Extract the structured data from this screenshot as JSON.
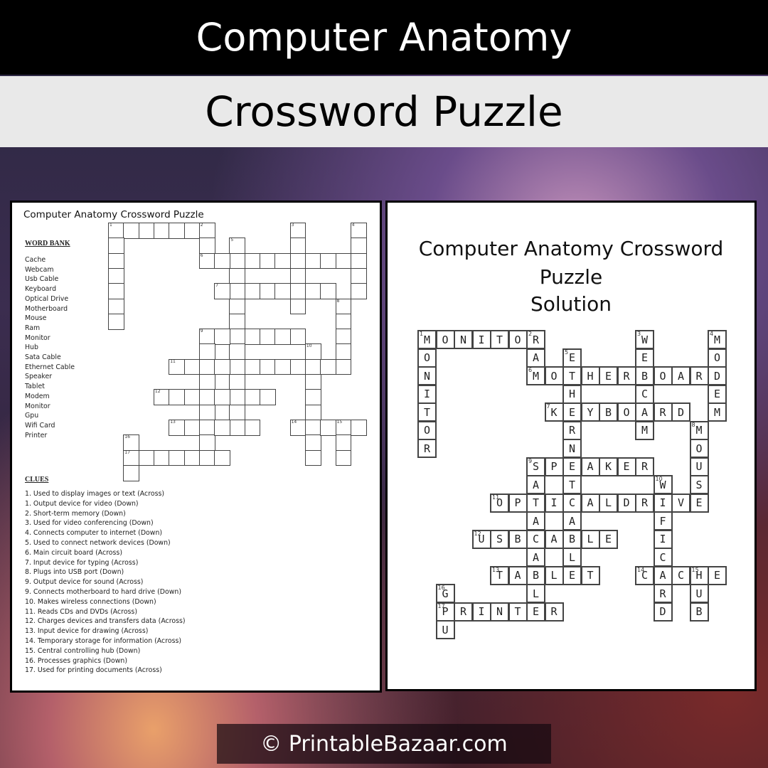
{
  "header": {
    "title": "Computer Anatomy",
    "subtitle": "Crossword Puzzle"
  },
  "puzzle": {
    "title": "Computer Anatomy Crossword Puzzle",
    "word_bank_heading": "WORD BANK",
    "word_bank": [
      "Cache",
      "Webcam",
      "Usb Cable",
      "Keyboard",
      "Optical Drive",
      "Motherboard",
      "Mouse",
      "Ram",
      "Monitor",
      "Hub",
      "Sata Cable",
      "Ethernet Cable",
      "Speaker",
      "Tablet",
      "Modem",
      "Monitor",
      "Gpu",
      "Wifi Card",
      "Printer"
    ],
    "clues_heading": "CLUES",
    "clues": [
      "1. Used to display images or text (Across)",
      "1. Output device for video (Down)",
      "2. Short-term  memory (Down)",
      "3. Used for video conferencing (Down)",
      "4. Connects computer to internet (Down)",
      "5. Used to connect network devices (Down)",
      "6. Main circuit board (Across)",
      "7. Input device for typing (Across)",
      "8. Plugs into USB port (Down)",
      "9. Output device for sound (Across)",
      "9. Connects motherboard  to hard drive (Down)",
      "10. Makes wireless connections (Down)",
      "11. Reads CDs and DVDs (Across)",
      "12. Charges devices and transfers data (Across)",
      "13. Input device for drawing (Across)",
      "14. Temporary storage for information (Across)",
      "15. Central controlling hub (Down)",
      "16. Processes graphics (Down)",
      "17. Used for printing documents (Across)"
    ]
  },
  "solution": {
    "title_line1": "Computer Anatomy Crossword",
    "title_line2": "Puzzle",
    "label": "Solution"
  },
  "grid_words": [
    {
      "n": 1,
      "dir": "across",
      "row": 0,
      "col": 0,
      "answer": "MONITOR"
    },
    {
      "n": 1,
      "dir": "down",
      "row": 0,
      "col": 0,
      "answer": "MONITOR"
    },
    {
      "n": 2,
      "dir": "down",
      "row": 0,
      "col": 6,
      "answer": "RAM"
    },
    {
      "n": 3,
      "dir": "down",
      "row": 0,
      "col": 12,
      "answer": "WEBCAM"
    },
    {
      "n": 4,
      "dir": "down",
      "row": 0,
      "col": 16,
      "answer": "MODEM"
    },
    {
      "n": 5,
      "dir": "down",
      "row": 1,
      "col": 8,
      "answer": "ETHERNETCABLE"
    },
    {
      "n": 6,
      "dir": "across",
      "row": 2,
      "col": 6,
      "answer": "MOTHERBOARD"
    },
    {
      "n": 7,
      "dir": "across",
      "row": 4,
      "col": 7,
      "answer": "KEYBOARD"
    },
    {
      "n": 8,
      "dir": "down",
      "row": 5,
      "col": 15,
      "answer": "MOUSE"
    },
    {
      "n": 9,
      "dir": "across",
      "row": 7,
      "col": 6,
      "answer": "SPEAKER"
    },
    {
      "n": 9,
      "dir": "down",
      "row": 7,
      "col": 6,
      "answer": "SATACABLE"
    },
    {
      "n": 10,
      "dir": "down",
      "row": 8,
      "col": 13,
      "answer": "WIFICARD"
    },
    {
      "n": 11,
      "dir": "across",
      "row": 9,
      "col": 4,
      "answer": "OPTICALDRIVE"
    },
    {
      "n": 12,
      "dir": "across",
      "row": 11,
      "col": 3,
      "answer": "USBCABLE"
    },
    {
      "n": 13,
      "dir": "across",
      "row": 13,
      "col": 4,
      "answer": "TABLET"
    },
    {
      "n": 14,
      "dir": "across",
      "row": 13,
      "col": 12,
      "answer": "CACHE"
    },
    {
      "n": 15,
      "dir": "down",
      "row": 13,
      "col": 15,
      "answer": "HUB"
    },
    {
      "n": 16,
      "dir": "down",
      "row": 14,
      "col": 1,
      "answer": "GPU"
    },
    {
      "n": 17,
      "dir": "across",
      "row": 15,
      "col": 1,
      "answer": "PRINTER"
    }
  ],
  "footer": {
    "copyright": "© PrintableBazaar.com"
  }
}
